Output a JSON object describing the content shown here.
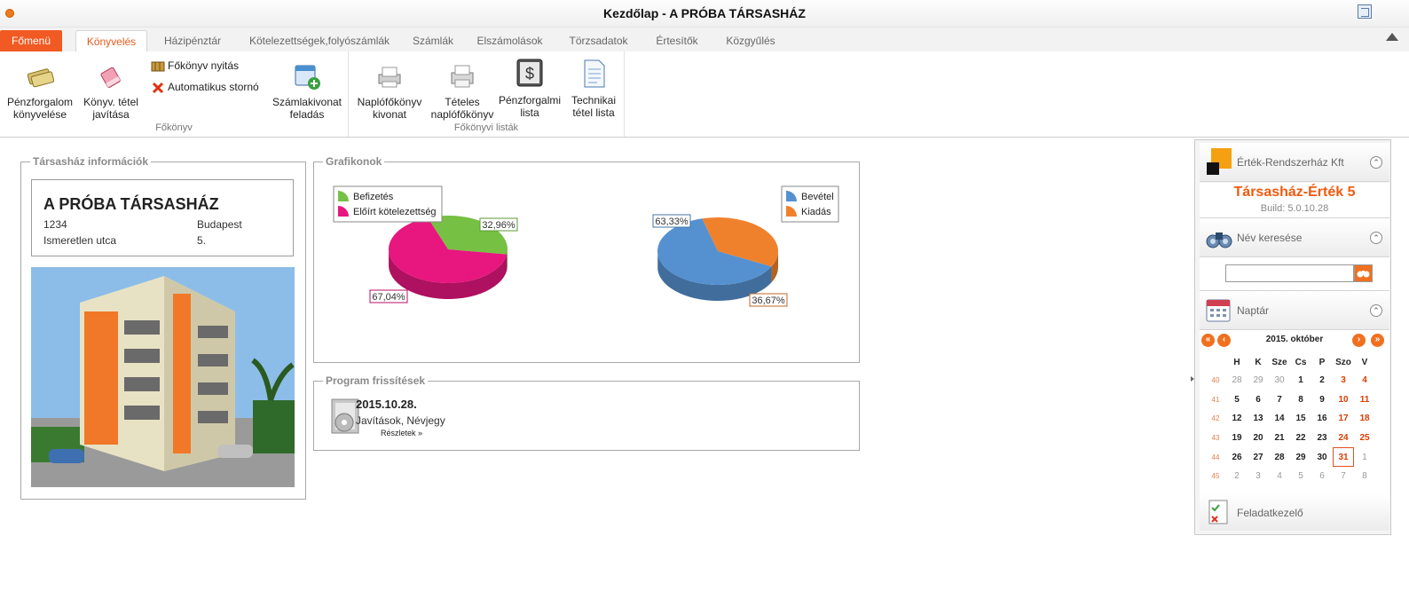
{
  "window": {
    "title": "Kezdőlap - A PRÓBA TÁRSASHÁZ"
  },
  "tabs": [
    "Főmenü",
    "Könyvelés",
    "Házipénztár",
    "Kötelezettségek,folyószámlák",
    "Számlák",
    "Elszámolások",
    "Törzsadatok",
    "Értesítők",
    "Közgyűlés"
  ],
  "ribbon": {
    "group1": {
      "label": "Főkönyv",
      "btn_penz": "Pénzforgalom könyvelése",
      "btn_konyv": "Könyv. tétel javítása",
      "small1": "Főkönyv nyitás",
      "small2": "Automatikus stornó",
      "btn_szamla": "Számlakivonat feladás"
    },
    "group2": {
      "label": "Főkönyvi listák",
      "btn_naplo": "Naplófőkönyv kivonat",
      "btn_teteles": "Tételes naplófőkönyv",
      "btn_penzlista": "Pénzforgalmi lista",
      "btn_technikai": "Technikai tétel lista"
    }
  },
  "info": {
    "legend": "Társasház információk",
    "name": "A PRÓBA TÁRSASHÁZ",
    "zip": "1234",
    "city": "Budapest",
    "street": "Ismeretlen utca",
    "number": "5."
  },
  "charts_panel": {
    "legend": "Grafikonok"
  },
  "chart_data": [
    {
      "type": "pie",
      "title": "",
      "series": [
        {
          "name": "Befizetés",
          "value": 32.96,
          "label": "32,96%",
          "color": "#76c043"
        },
        {
          "name": "Előírt kötelezettség",
          "value": 67.04,
          "label": "67,04%",
          "color": "#e8167f"
        }
      ]
    },
    {
      "type": "pie",
      "title": "",
      "series": [
        {
          "name": "Bevétel",
          "value": 63.33,
          "label": "63,33%",
          "color": "#5591d0"
        },
        {
          "name": "Kiadás",
          "value": 36.67,
          "label": "36,67%",
          "color": "#f0812c"
        }
      ]
    }
  ],
  "updates": {
    "legend": "Program frissítések",
    "date": "2015.10.28.",
    "text": "Javítások, Névjegy",
    "link": "Részletek »"
  },
  "sidebar": {
    "company": "Érték-Rendszerház Kft",
    "product": "Társasház-Érték 5",
    "build": "Build: 5.0.10.28",
    "search_title": "Név keresése",
    "search_value": "",
    "calendar_title": "Naptár",
    "task_title": "Feladatkezelő"
  },
  "calendar": {
    "month": "2015. október",
    "headers": [
      "H",
      "K",
      "Sze",
      "Cs",
      "P",
      "Szo",
      "V"
    ],
    "weeks": [
      {
        "wk": "40",
        "days": [
          "28",
          "29",
          "30",
          "1",
          "2",
          "3",
          "4"
        ]
      },
      {
        "wk": "41",
        "days": [
          "5",
          "6",
          "7",
          "8",
          "9",
          "10",
          "11"
        ]
      },
      {
        "wk": "42",
        "days": [
          "12",
          "13",
          "14",
          "15",
          "16",
          "17",
          "18"
        ]
      },
      {
        "wk": "43",
        "days": [
          "19",
          "20",
          "21",
          "22",
          "23",
          "24",
          "25"
        ]
      },
      {
        "wk": "44",
        "days": [
          "26",
          "27",
          "28",
          "29",
          "30",
          "31",
          "1"
        ]
      },
      {
        "wk": "45",
        "days": [
          "2",
          "3",
          "4",
          "5",
          "6",
          "7",
          "8"
        ]
      }
    ],
    "today": "31"
  },
  "colors": {
    "accent": "#f15a22",
    "tab_active_text": "#e85a1c",
    "product_title": "#f05a10"
  }
}
